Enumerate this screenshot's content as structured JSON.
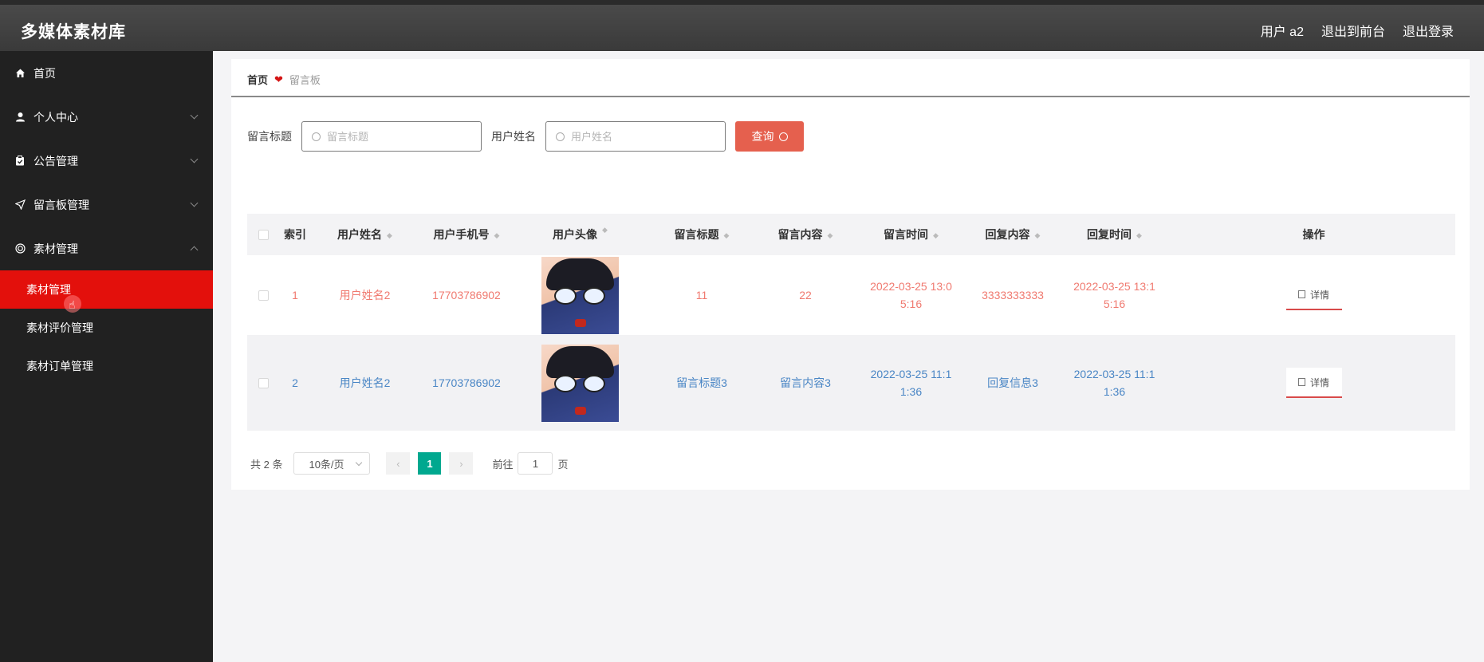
{
  "header": {
    "app_title": "多媒体素材库",
    "user_label": "用户 a2",
    "front_label": "退出到前台",
    "logout_label": "退出登录"
  },
  "sidebar": {
    "items": [
      {
        "label": "首页",
        "icon": "home-icon"
      },
      {
        "label": "个人中心",
        "icon": "user-icon"
      },
      {
        "label": "公告管理",
        "icon": "clipboard-icon"
      },
      {
        "label": "留言板管理",
        "icon": "send-icon"
      },
      {
        "label": "素材管理",
        "icon": "globe-icon"
      }
    ],
    "sub_items": [
      {
        "label": "素材管理"
      },
      {
        "label": "素材评价管理"
      },
      {
        "label": "素材订单管理"
      }
    ],
    "active_color": "#e3100c"
  },
  "breadcrumb": {
    "home": "首页",
    "current": "留言板"
  },
  "search": {
    "title_label": "留言标题",
    "title_placeholder": "留言标题",
    "name_label": "用户姓名",
    "name_placeholder": "用户姓名",
    "query_label": "查询"
  },
  "table": {
    "headers": [
      "索引",
      "用户姓名",
      "用户手机号",
      "用户头像",
      "留言标题",
      "留言内容",
      "留言时间",
      "回复内容",
      "回复时间",
      "操作"
    ],
    "rows": [
      {
        "index": "1",
        "name": "用户姓名2",
        "phone": "17703786902",
        "title": "11",
        "content": "22",
        "time_a": "2022-03-25 13:0",
        "time_b": "5:16",
        "reply": "3333333333",
        "rtime_a": "2022-03-25 13:1",
        "rtime_b": "5:16",
        "detail": "详情"
      },
      {
        "index": "2",
        "name": "用户姓名2",
        "phone": "17703786902",
        "title": "留言标题3",
        "content": "留言内容3",
        "time_a": "2022-03-25 11:1",
        "time_b": "1:36",
        "reply": "回复信息3",
        "rtime_a": "2022-03-25 11:1",
        "rtime_b": "1:36",
        "detail": "详情"
      }
    ]
  },
  "pager": {
    "total": "共 2 条",
    "page_size": "10条/页",
    "current_page": "1",
    "goto_label": "前往",
    "goto_value": "1",
    "page_unit": "页",
    "accent": "#00a88f"
  }
}
